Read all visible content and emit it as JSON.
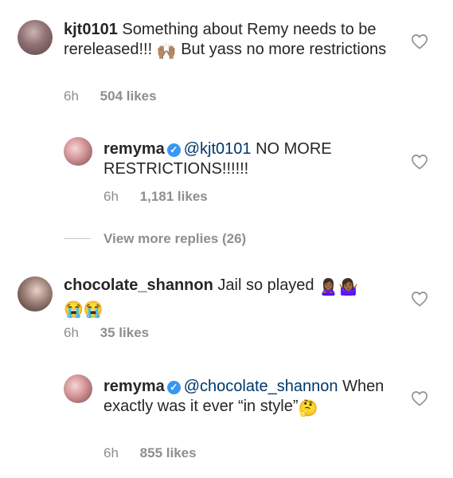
{
  "comments": [
    {
      "username": "kjt0101",
      "verified": false,
      "mention": "",
      "text_part1": "Something about Remy needs to be rereleased!!!",
      "emoji1": "🙌🏽",
      "text_part2": "But yass no more restrictions",
      "time": "6h",
      "likes": "504 likes"
    },
    {
      "username": "remyma",
      "verified": true,
      "mention": "@kjt0101",
      "text": "NO MORE RESTRICTIONS!!!!!!",
      "time": "6h",
      "likes": "1,181 likes"
    },
    {
      "username": "chocolate_shannon",
      "verified": false,
      "mention": "",
      "text": "Jail so played",
      "emojis_line1": "🙎🏾‍♀️🤷🏾‍♀️",
      "emojis_line2": "😭😭",
      "time": "6h",
      "likes": "35 likes"
    },
    {
      "username": "remyma",
      "verified": true,
      "mention": "@chocolate_shannon",
      "text_part1": "When exactly was it ever “in style”",
      "emoji1": "🤔",
      "time": "6h",
      "likes": "855 likes"
    }
  ],
  "view_more": "View more replies (26)",
  "icons": {
    "heart": "heart-outline-icon",
    "verified": "verified-badge-icon"
  },
  "colors": {
    "text": "#262626",
    "secondary": "#8e8e8e",
    "mention": "#00376b",
    "verified": "#3897f0"
  }
}
